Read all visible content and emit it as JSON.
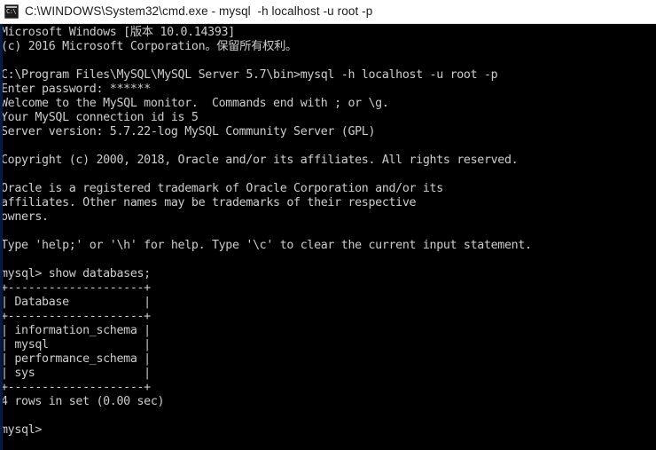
{
  "window": {
    "title": "C:\\WINDOWS\\System32\\cmd.exe - mysql  -h localhost -u root -p",
    "icon": "cmd-console-icon",
    "icon_glyph": "C:\\",
    "titlebar_bg": "#ffffff",
    "titlebar_fg": "#1a1a1a",
    "console_bg": "#000000",
    "console_fg": "#cccccc"
  },
  "console": {
    "lines": [
      "Microsoft Windows [版本 10.0.14393]",
      "(c) 2016 Microsoft Corporation。保留所有权利。",
      "",
      "C:\\Program Files\\MySQL\\MySQL Server 5.7\\bin>mysql -h localhost -u root -p",
      "Enter password: ******",
      "Welcome to the MySQL monitor.  Commands end with ; or \\g.",
      "Your MySQL connection id is 5",
      "Server version: 5.7.22-log MySQL Community Server (GPL)",
      "",
      "Copyright (c) 2000, 2018, Oracle and/or its affiliates. All rights reserved.",
      "",
      "Oracle is a registered trademark of Oracle Corporation and/or its",
      "affiliates. Other names may be trademarks of their respective",
      "owners.",
      "",
      "Type 'help;' or '\\h' for help. Type '\\c' to clear the current input statement.",
      "",
      "mysql> show databases;",
      "+--------------------+",
      "| Database           |",
      "+--------------------+",
      "| information_schema |",
      "| mysql              |",
      "| performance_schema |",
      "| sys                |",
      "+--------------------+",
      "4 rows in set (0.00 sec)",
      "",
      "mysql>"
    ],
    "prompt": "mysql>",
    "command": "show databases;",
    "result_table": {
      "columns": [
        "Database"
      ],
      "rows": [
        [
          "information_schema"
        ],
        [
          "mysql"
        ],
        [
          "performance_schema"
        ],
        [
          "sys"
        ]
      ],
      "summary": "4 rows in set (0.00 sec)"
    },
    "shell_path": "C:\\Program Files\\MySQL\\MySQL Server 5.7\\bin",
    "shell_command": "mysql -h localhost -u root -p",
    "password_masked": "******",
    "connection_id": "5",
    "server_version": "5.7.22-log MySQL Community Server (GPL)"
  }
}
